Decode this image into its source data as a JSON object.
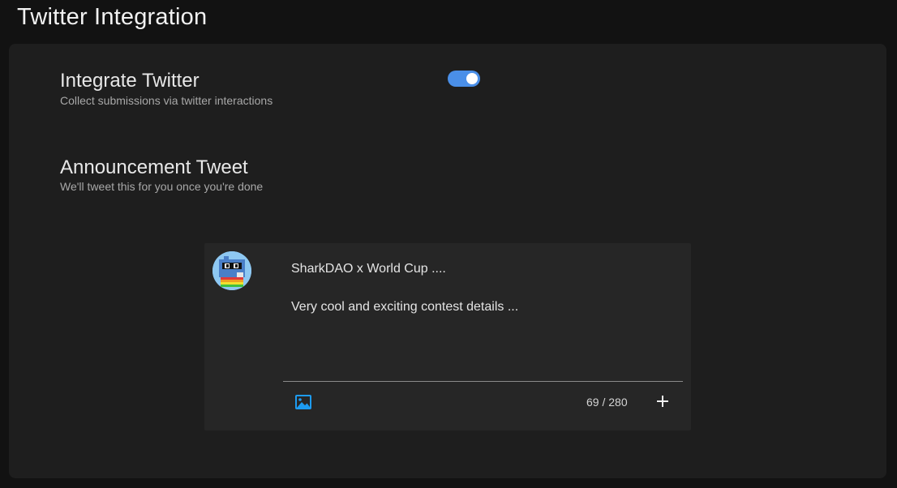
{
  "header": {
    "title": "Twitter Integration"
  },
  "integrate": {
    "title": "Integrate Twitter",
    "subtitle": "Collect submissions via twitter interactions",
    "enabled": true
  },
  "announcement": {
    "title": "Announcement Tweet",
    "subtitle": "We'll tweet this for you once you're done"
  },
  "tweet": {
    "line1": "SharkDAO x World Cup ....",
    "line2": "Very cool and exciting contest details ...",
    "char_count": "69 / 280",
    "avatar_icon": "shark-avatar-icon",
    "image_icon": "image-icon",
    "add_icon": "plus-icon"
  },
  "colors": {
    "accent": "#4a8fe8",
    "icon_blue": "#1d9bf0",
    "background": "#121212",
    "panel": "#1e1e1e",
    "tweet_box": "#262626"
  }
}
